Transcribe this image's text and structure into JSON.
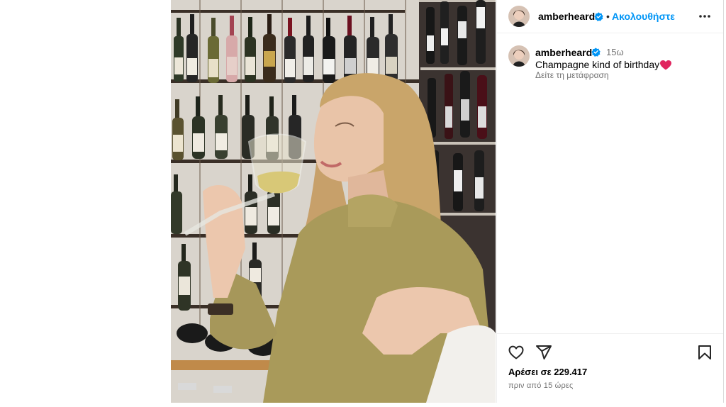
{
  "post": {
    "username": "amberheard",
    "follow_label": "Ακολουθήστε",
    "separator": "•",
    "caption_username": "amberheard",
    "caption_time": "15ω",
    "caption_text": "Champagne kind of birthday",
    "translate_label": "Δείτε τη μετάφραση",
    "likes_text": "Αρέσει σε 229.417",
    "posted_ago": "πριν από 15 ώρες"
  },
  "icons": {
    "verified": "verified-badge-icon",
    "more": "more-options-icon",
    "like": "heart-outline-icon",
    "share": "paper-plane-icon",
    "save": "bookmark-icon",
    "emoji": "red-heart-emoji"
  },
  "colors": {
    "link_blue": "#0095f6",
    "secondary_text": "#737373",
    "verified_blue": "#0095f6"
  }
}
